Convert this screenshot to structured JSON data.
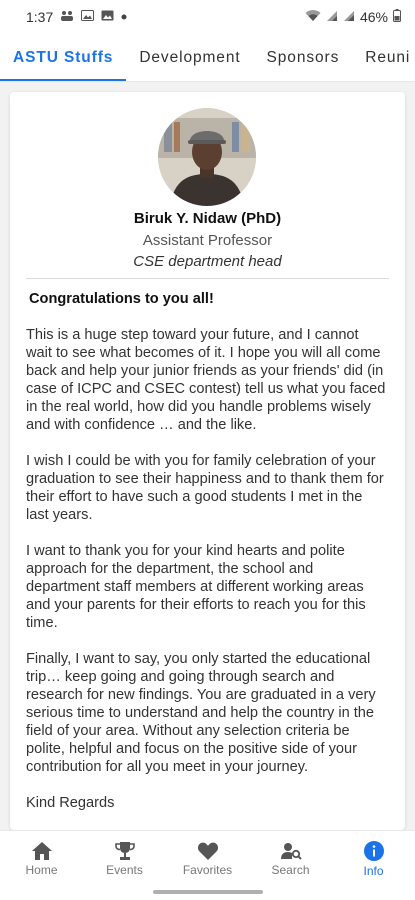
{
  "status_bar": {
    "time": "1:37",
    "battery": "46%",
    "left_icons": [
      "teams-icon",
      "image-icon",
      "image-icon",
      "dot-icon"
    ],
    "right_icons": [
      "wifi-icon",
      "signal-icon",
      "signal-icon",
      "battery-icon"
    ]
  },
  "tabs": [
    {
      "label": "ASTU Stuffs",
      "active": true
    },
    {
      "label": "Development",
      "active": false
    },
    {
      "label": "Sponsors",
      "active": false
    },
    {
      "label": "Reuni",
      "active": false
    }
  ],
  "profile": {
    "name": "Biruk Y. Nidaw (PhD)",
    "title": "Assistant Professor",
    "role": "CSE department head"
  },
  "message": {
    "greeting": "Congratulations to you all!",
    "paragraphs": [
      "This is a huge step toward your future, and I cannot wait to see what becomes of it. I hope you will all come back and help your junior friends as your friends' did (in case of ICPC and CSEC contest) tell us what you faced in the real world, how did you handle problems wisely and with confidence … and the like.",
      "I wish I could be with you for family celebration of your graduation to see their happiness and to thank them for their effort to have such a good students I met in the last years.",
      "I want to thank you for your kind hearts and polite approach for the department, the school and department staff members at different working areas and your parents for their efforts to reach you for this time.",
      "Finally, I want to say, you only started the educational trip… keep going and going through search and research for new findings. You are graduated in a very serious time to understand and help the country in the field of your area. Without any selection criteria be polite, helpful and focus on the positive side of your contribution for all you meet in your journey."
    ],
    "closing": "Kind Regards"
  },
  "bottom_nav": [
    {
      "label": "Home",
      "icon": "home-icon",
      "active": false
    },
    {
      "label": "Events",
      "icon": "trophy-icon",
      "active": false
    },
    {
      "label": "Favorites",
      "icon": "heart-icon",
      "active": false
    },
    {
      "label": "Search",
      "icon": "person-search-icon",
      "active": false
    },
    {
      "label": "Info",
      "icon": "info-icon",
      "active": true
    }
  ],
  "colors": {
    "accent": "#1a73e8",
    "inactive": "#777777",
    "background": "#f2f2f2"
  }
}
